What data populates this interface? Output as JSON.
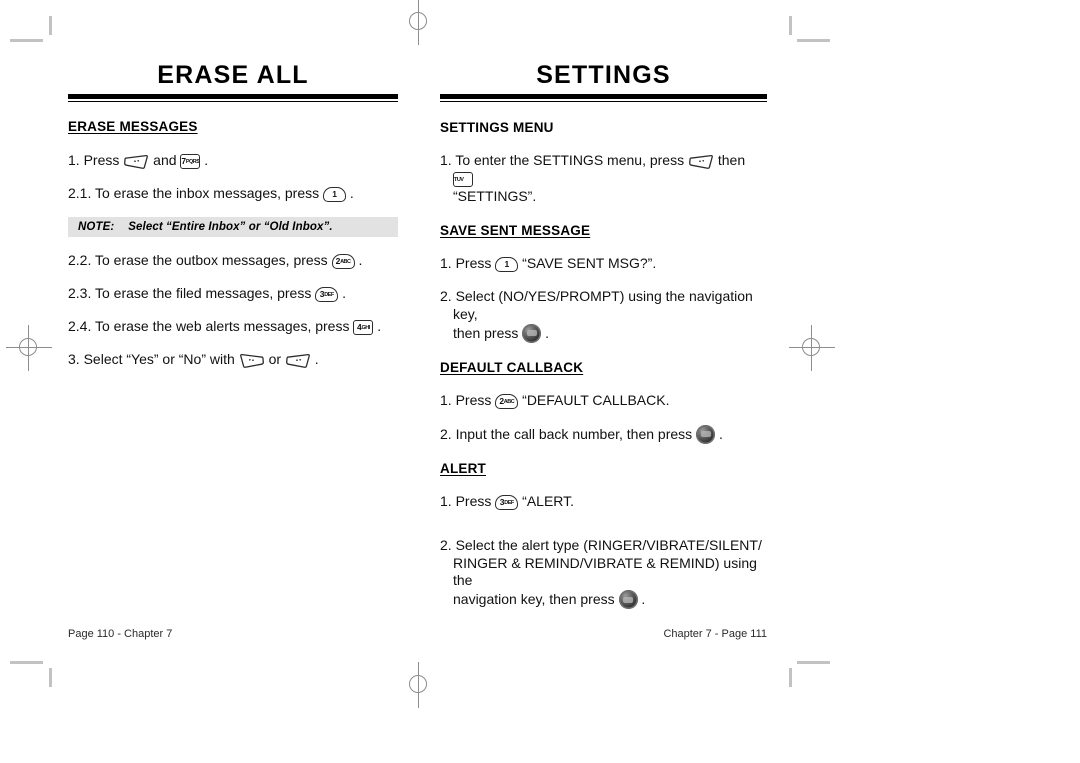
{
  "document": {
    "type": "printed-manual-spread"
  },
  "left_page": {
    "title": "ERASE ALL",
    "section": {
      "heading": "ERASE MESSAGES",
      "underlined": true
    },
    "steps": [
      {
        "number": "1.",
        "text_before": "Press",
        "key1": "softkey-menu",
        "text_middle": "and",
        "key2_num": "7",
        "key2_sub": "PQRS",
        "text_after": "."
      },
      {
        "number": "2.1.",
        "text_before": "To erase the inbox messages, press",
        "key_num": "1",
        "key_sub": "",
        "text_after": "."
      },
      {
        "number": "2.2.",
        "text_before": "To erase the outbox messages, press",
        "key_num": "2",
        "key_sub": "ABC",
        "text_after": "."
      },
      {
        "number": "2.3.",
        "text_before": "To erase the filed messages, press",
        "key_num": "3",
        "key_sub": "DEF",
        "text_after": "."
      },
      {
        "number": "2.4.",
        "text_before": "To erase the web alerts messages, press",
        "key_num": "4",
        "key_sub": "GHI",
        "text_after": "."
      },
      {
        "number": "3.",
        "text_before": "Select “Yes” or “No” with",
        "key1": "softkey-left",
        "text_middle": "or",
        "key2": "softkey-right",
        "text_after": "."
      }
    ],
    "note": {
      "label": "NOTE:",
      "text": "Select “Entire Inbox” or “Old Inbox”."
    },
    "footer": "Page 110 - Chapter 7"
  },
  "right_page": {
    "title": "SETTINGS",
    "sections": [
      {
        "heading": "SETTINGS MENU",
        "underlined": false,
        "steps": [
          {
            "number": "1.",
            "line1_before": "To enter the SETTINGS menu, press",
            "key1": "softkey-menu",
            "line1_middle": "then",
            "key2_num": "8",
            "key2_sub": "TUV",
            "line2": "“SETTINGS”."
          }
        ]
      },
      {
        "heading": "SAVE SENT MESSAGE",
        "underlined": true,
        "steps": [
          {
            "number": "1.",
            "text_before": "Press",
            "key_num": "1",
            "key_sub": "",
            "text_after": "“SAVE SENT MSG?”."
          },
          {
            "number": "2.",
            "line1": "Select (NO/YES/PROMPT) using the navigation key,",
            "line2_before": "then press",
            "key": "ok-key",
            "line2_after": "."
          }
        ]
      },
      {
        "heading": "DEFAULT CALLBACK",
        "underlined": true,
        "steps": [
          {
            "number": "1.",
            "text_before": "Press",
            "key_num": "2",
            "key_sub": "ABC",
            "text_after": "“DEFAULT CALLBACK."
          },
          {
            "number": "2.",
            "text_before": "Input the call back number, then press",
            "key": "ok-key",
            "text_after": "."
          }
        ]
      },
      {
        "heading": "ALERT",
        "underlined": true,
        "steps": [
          {
            "number": "1.",
            "text_before": "Press",
            "key_num": "3",
            "key_sub": "DEF",
            "text_after": "“ALERT."
          },
          {
            "number": "2.",
            "line1": "Select the alert type (RINGER/VIBRATE/SILENT/",
            "line2": "RINGER & REMIND/VIBRATE & REMIND) using the",
            "line3_before": "navigation key, then press",
            "key": "ok-key",
            "line3_after": "."
          }
        ]
      }
    ],
    "footer": "Chapter 7 - Page 111"
  },
  "colors": {
    "page_background": "#ffffff",
    "text": "#000000",
    "note_background": "#e2e2e2",
    "crop_mark": "#c2c2c2",
    "registration_mark": "#8d8d8d"
  }
}
